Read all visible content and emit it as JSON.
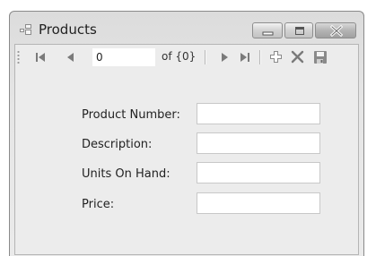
{
  "window": {
    "title": "Products",
    "controls": {
      "minimize_icon": "minimize-icon",
      "maximize_icon": "maximize-icon",
      "close_icon": "close-icon"
    }
  },
  "navigator": {
    "position_value": "0",
    "count_text": "of {0}",
    "icons": [
      "move-first-icon",
      "move-previous-icon",
      "move-next-icon",
      "move-last-icon",
      "add-new-icon",
      "delete-icon",
      "save-icon"
    ]
  },
  "form": {
    "product_number_label": "Product Number:",
    "description_label": "Description:",
    "units_on_hand_label": "Units On Hand:",
    "price_label": "Price:",
    "product_number_value": "",
    "description_value": "",
    "units_on_hand_value": "",
    "price_value": ""
  },
  "colors": {
    "window_bg": "#e6e6e6",
    "field_bg": "#ffffff",
    "icon_gray": "#7a7a7a",
    "close_button": "#a8a8a8"
  }
}
